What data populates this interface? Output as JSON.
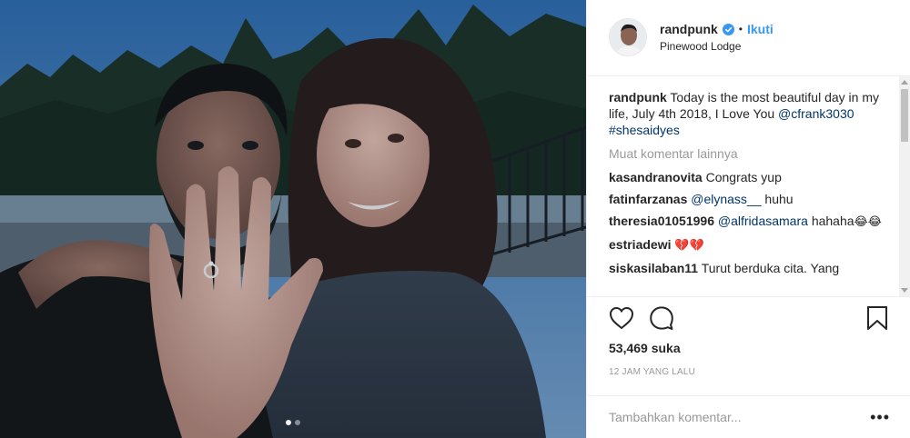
{
  "post": {
    "image_alt": "Engagement photo",
    "carousel": {
      "count": 2,
      "active": 1
    }
  },
  "header": {
    "username": "randpunk",
    "separator": "•",
    "follow_label": "Ikuti",
    "location": "Pinewood Lodge"
  },
  "caption": {
    "username": "randpunk",
    "text": "Today is the most beautiful day in my life, July 4th 2018, I Love You",
    "mention": "@cfrank3030",
    "hashtag": "#shesaidyes"
  },
  "load_more_label": "Muat komentar lainnya",
  "comments": [
    {
      "username": "kasandranovita",
      "text": "Congrats yup",
      "mention": "",
      "suffix": "",
      "emoji": ""
    },
    {
      "username": "fatinfarzanas",
      "text": "",
      "mention": "@elynass__",
      "suffix": "huhu",
      "emoji": ""
    },
    {
      "username": "theresia01051996",
      "text": "",
      "mention": "@alfridasamara",
      "suffix": "hahaha",
      "emoji": "😂😂"
    },
    {
      "username": "estriadewi",
      "text": "",
      "mention": "",
      "suffix": "",
      "emoji": "💔💔"
    },
    {
      "username": "siskasilaban11",
      "text": "Turut berduka cita. Yang",
      "mention": "",
      "suffix": "",
      "emoji": ""
    }
  ],
  "likes_label": "53,469 suka",
  "timestamp": "12 JAM YANG LALU",
  "add_comment_placeholder": "Tambahkan komentar...",
  "more_options": "•••",
  "colors": {
    "link_blue": "#3897f0",
    "tag_navy": "#003569",
    "muted_gray": "#999999",
    "text": "#262626",
    "border": "#efefef",
    "heartbreak_red": "#be1931"
  },
  "icons": [
    "verified-badge-icon",
    "heart-icon",
    "comment-icon",
    "bookmark-icon",
    "more-options-icon"
  ]
}
